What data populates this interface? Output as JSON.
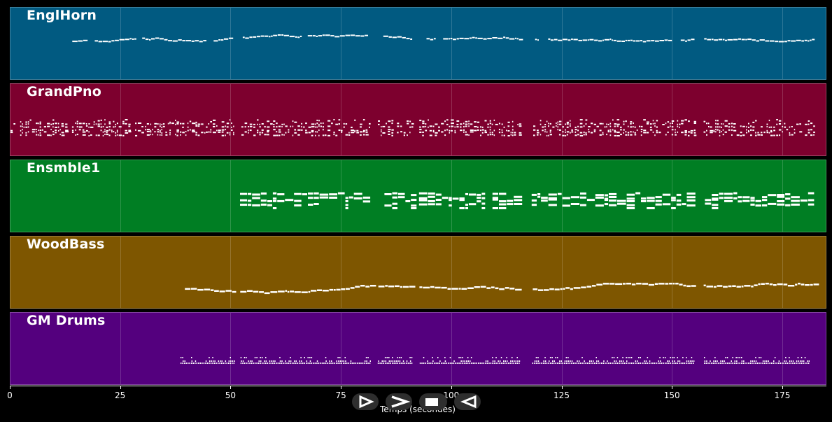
{
  "tracks": [
    {
      "name": "EnglHorn",
      "color": "#015a81",
      "lane": "melody",
      "start": 14,
      "end": 182
    },
    {
      "name": "GrandPno",
      "color": "#7d002e",
      "lane": "piano",
      "start": 0,
      "end": 182
    },
    {
      "name": "Ensmble1",
      "color": "#007e23",
      "lane": "ensemble",
      "start": 52,
      "end": 182
    },
    {
      "name": "WoodBass",
      "color": "#7e5600",
      "lane": "bass",
      "start": 39.5,
      "end": 182
    },
    {
      "name": "GM Drums",
      "color": "#54007e",
      "lane": "drums",
      "start": 38.5,
      "end": 181
    }
  ],
  "gaps": [
    [
      50.5,
      52
    ],
    [
      81.5,
      83
    ],
    [
      91,
      92.5
    ],
    [
      115.5,
      118
    ],
    [
      155,
      157
    ]
  ],
  "axis": {
    "label": "Temps (secondes)",
    "xlim": [
      0,
      185
    ],
    "ticks": [
      0,
      25,
      50,
      75,
      100,
      125,
      150,
      175
    ],
    "tick_labels": [
      "0",
      "25",
      "50",
      "75",
      "100",
      "125",
      "150",
      "175"
    ]
  },
  "controls": [
    {
      "name": "play-button",
      "icon": "play-icon"
    },
    {
      "name": "forward-button",
      "icon": "chevron-right-icon"
    },
    {
      "name": "stop-button",
      "icon": "stop-icon"
    },
    {
      "name": "rewind-button",
      "icon": "rewind-icon"
    }
  ],
  "note_color": "#ffffff"
}
